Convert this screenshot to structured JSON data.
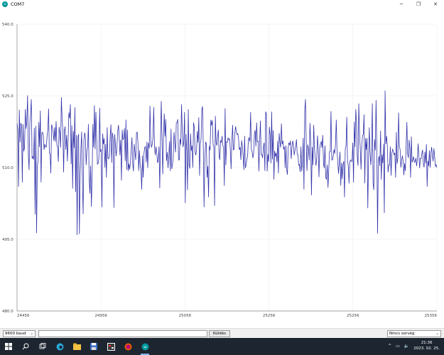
{
  "window": {
    "title": "COM7",
    "controls": {
      "minimize": "─",
      "maximize": "❐",
      "close": "✕"
    }
  },
  "plotter": {
    "y_ticks": [
      "540.0",
      "525.0",
      "510.0",
      "495.0",
      "480.0"
    ],
    "x_ticks": [
      "24456",
      "24956",
      "25056",
      "25256",
      "25256",
      "25356"
    ],
    "line_color": "#3333aa",
    "gridlines": true
  },
  "chart_data": {
    "type": "line",
    "ylim": [
      480,
      540
    ],
    "x_range": [
      24456,
      25356
    ],
    "series": [
      {
        "values": [
          519.2,
          517.9,
          506.0,
          522.1,
          515.3,
          519.3,
          518.8,
          506.9,
          519.1,
          513.4,
          514.2,
          522.2,
          518.1,
          519.6,
          525.1,
          513.0,
          509.5,
          519.2,
          521.2,
          524.3,
          511.9,
          512.3,
          511.7,
          518.3,
          500.2,
          518.7,
          496.3,
          510.4,
          511.4,
          519.5,
          514.3,
          521.9,
          506.9,
          517.2,
          517.4,
          516.7,
          513.7,
          514.9,
          514.3,
          514.3,
          516.6,
          518.0,
          522.3,
          513.0,
          512.9,
          508.8,
          519.0,
          518.4,
          517.4,
          515.6,
          518.4,
          515.4,
          519.7,
          514.8,
          514.2,
          511.2,
          518.5,
          517.2,
          514.2,
          524.7,
          520.2,
          517.8,
          509.0,
          517.6,
          518.6,
          513.7,
          516.8,
          511.3,
          515.7,
          521.5,
          520.3,
          523.2,
          510.7,
          518.8,
          505.6,
          517.6,
          514.1,
          522.6,
          504.9,
          516.8,
          495.9,
          516.3,
          517.0,
          496.1,
          508.9,
          513.8,
          517.5,
          507.1,
          500.3,
          515.6,
          517.3,
          516.4,
          510.5,
          513.6,
          514.3,
          519.1,
          507.5,
          504.6,
          510.4,
          501.8,
          508.6,
          519.1,
          514.2,
          523.0,
          513.8,
          521.6,
          516.1,
          510.7,
          510.9,
          512.0,
          522.5,
          513.3,
          513.8,
          501.7,
          517.1,
          514.9,
          516.1,
          510.0,
          514.9,
          507.9,
          518.4,
          512.0,
          511.8,
          512.4,
          516.4,
          519.0,
          511.0,
          517.3,
          516.1,
          501.6,
          517.0,
          514.6,
          512.4,
          514.4,
          517.5,
          518.9,
          516.7,
          512.6,
          515.8,
          507.3,
          517.9,
          515.8,
          516.2,
          518.2,
          511.4,
          520.0,
          509.5,
          517.9,
          509.3,
          510.8,
          509.6,
          511.2,
          513.7,
          516.3,
          510.9,
          509.2,
          514.9,
          513.3,
          511.6,
          517.3,
          517.4,
          515.1,
          509.3,
          513.6,
          510.5,
          509.6,
          505.4,
          512.5,
          507.9,
          513.0,
          514.2,
          514.4,
          511.1,
          515.4,
          509.9,
          515.2,
          514.0,
          522.9,
          515.6,
          514.2,
          514.9,
          516.3,
          522.6,
          514.3,
          512.6,
          514.4,
          513.1,
          511.0,
          511.4,
          514.4,
          505.7,
          515.3,
          523.9,
          516.2,
          508.6,
          516.5,
          521.3,
          516.5,
          520.1,
          511.4,
          513.2,
          509.9,
          512.3,
          515.5,
          509.3,
          518.1,
          509.7,
          510.7,
          512.0,
          517.4,
          515.3,
          513.2,
          519.3,
          519.4,
          520.1,
          511.6,
          511.6,
          516.0,
          514.8,
          523.2,
          517.4,
          514.3,
          515.3,
          521.6,
          502.6,
          517.0,
          513.5,
          505.3,
          522.2,
          510.6,
          509.8,
          517.1,
          513.5,
          514.6,
          510.0,
          519.4,
          518.5,
          513.3,
          512.6,
          513.7,
          517.6,
          515.2,
          520.5,
          508.3,
          515.0,
          516.0,
          522.1,
          522.8,
          514.1,
          501.7,
          511.3,
          515.3,
          515.1,
          507.9,
          510.3,
          503.8,
          514.5,
          513.6,
          520.0,
          518.8,
          519.9,
          514.9,
          514.4,
          502.0,
          520.8,
          515.2,
          514.6,
          516.6,
          517.9,
          512.5,
          511.6,
          515.7,
          515.2,
          516.6,
          514.6,
          514.3,
          506.2,
          522.4,
          510.5,
          515.4,
          515.3,
          516.2,
          515.8,
          516.0,
          513.7,
          509.7,
          515.6,
          518.9,
          513.7,
          513.8,
          517.2,
          518.6,
          517.4,
          516.9,
          517.1,
          515.9,
          513.7,
          514.3,
          511.6,
          515.7,
          514.4,
          512.4,
          509.5,
          516.6,
          509.9,
          510.6,
          511.8,
          512.4,
          515.9,
          516.2,
          515.4,
          521.6,
          513.8,
          513.3,
          512.0,
          513.0,
          517.0,
          517.8,
          514.4,
          519.4,
          515.4,
          515.5,
          509.2,
          515.3,
          519.8,
          512.7,
          512.7,
          512.0,
          514.4,
          515.2,
          509.3,
          521.7,
          521.2,
          509.2,
          512.8,
          511.2,
          518.5,
          516.8,
          510.9,
          521.7,
          511.7,
          517.8,
          507.5,
          513.5,
          512.3,
          513.1,
          511.1,
          515.6,
          508.8,
          517.2,
          515.3,
          514.2,
          519.2,
          514.9,
          515.6,
          513.8,
          514.4,
          509.9,
          514.6,
          509.6,
          508.5,
          514.2,
          515.2,
          514.7,
          515.6,
          511.8,
          514.1,
          515.6,
          514.8,
          512.6,
          513.6,
          514.4,
          515.9,
          512.8,
          512.7,
          510.5,
          510.6,
          509.1,
          514.4,
          509.2,
          510.9,
          516.2,
          505.4,
          521.6,
          524.3,
          515.4,
          509.3,
          514.8,
          513.9,
          511.5,
          519.3,
          515.3,
          504.2,
          514.3,
          510.5,
          518.9,
          513.9,
          512.1,
          510.4,
          512.0,
          516.7,
          513.9,
          508.0,
          514.0,
          515.1,
          515.4,
          514.1,
          516.8,
          510.8,
          509.9,
          514.6,
          507.9,
          507.5,
          510.6,
          505.8,
          509.6,
          513.3,
          513.3,
          521.8,
          511.6,
          511.6,
          512.4,
          513.8,
          512.9,
          514.9,
          520.0,
          513.7,
          511.2,
          508.7,
          511.0,
          513.3,
          506.2,
          511.0,
          507.6,
          510.7,
          511.3,
          503.8,
          513.9,
          514.5,
          520.6,
          511.5,
          510.4,
          506.7,
          511.2,
          511.6,
          511.3,
          511.3,
          515.2,
          506.9,
          519.6,
          514.3,
          522.2,
          519.4,
          512.2,
          510.4,
          523.4,
          517.1,
          513.9,
          509.6,
          514.7,
          516.6,
          517.0,
          521.1,
          506.7,
          516.1,
          513.7,
          516.2,
          501.5,
          511.8,
          518.4,
          513.0,
          510.5,
          513.2,
          523.4,
          506.8,
          505.3,
          515.9,
          513.6,
          524.1,
          514.2,
          496.2,
          511.3,
          512.4,
          510.3,
          517.7,
          507.5,
          512.7,
          510.9,
          515.0,
          500.5,
          526.1,
          514.9,
          516.6,
          514.6,
          509.0,
          510.5,
          510.5,
          514.4,
          508.3,
          512.9,
          513.8,
          513.4,
          512.6,
          513.1,
          507.9,
          517.4,
          510.8,
          512.0,
          521.5,
          514.4,
          513.8,
          510.0,
          511.5,
          512.5,
          511.4,
          508.4,
          510.9,
          509.3,
          514.5,
          519.5,
          513.0,
          512.0,
          515.8,
          513.9,
          507.9,
          516.5,
          511.1,
          511.6,
          512.3,
          511.1,
          511.2,
          512.0,
          510.3,
          511.9,
          515.0,
          512.5,
          509.9,
          511.9,
          511.8,
          513.0,
          513.7,
          510.6,
          510.1,
          513.3,
          510.9,
          514.9,
          506.0,
          511.4,
          510.3,
          513.6,
          510.0,
          512.9,
          514.3,
          512.5,
          511.3,
          514.0,
          512.3,
          510.3,
          510.6,
          510.0
        ]
      }
    ]
  },
  "bottom_bar": {
    "baud": "9600 baud",
    "send_placeholder": "",
    "send_button": "Küldés",
    "line_ending": "Nincs sorvég",
    "caret": "⌄"
  },
  "taskbar": {
    "icons": [
      "windows-icon",
      "search-icon",
      "task-view-icon",
      "edge-icon",
      "file-explorer-icon",
      "floppy-icon",
      "photo-app-icon",
      "firefox-icon",
      "arduino-icon"
    ],
    "time": "21:36",
    "date": "2023. 02. 25.",
    "tray": {
      "chevron": "^",
      "battery": "▭",
      "volume": "🔈"
    }
  }
}
